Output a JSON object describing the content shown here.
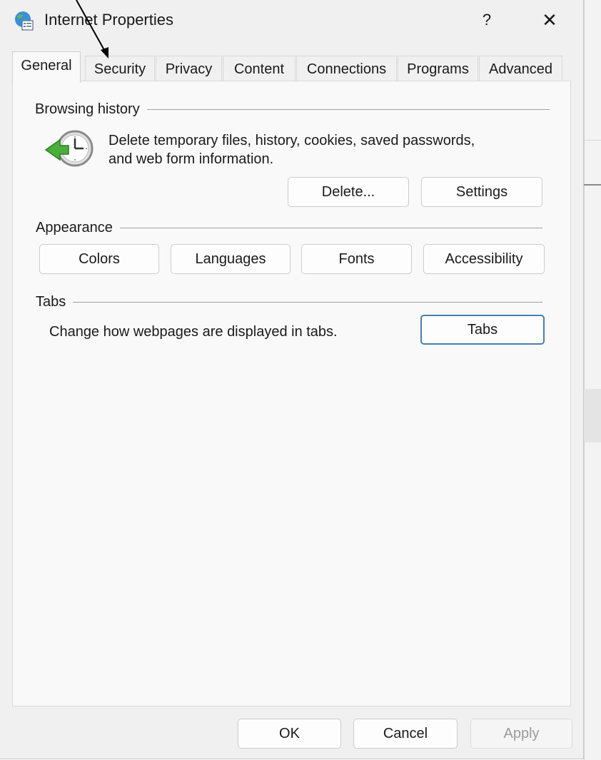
{
  "window": {
    "title": "Internet Properties",
    "help_label": "?",
    "close_label": "✕"
  },
  "tabs": [
    {
      "label": "General",
      "active": true
    },
    {
      "label": "Security",
      "active": false
    },
    {
      "label": "Privacy",
      "active": false
    },
    {
      "label": "Content",
      "active": false
    },
    {
      "label": "Connections",
      "active": false
    },
    {
      "label": "Programs",
      "active": false
    },
    {
      "label": "Advanced",
      "active": false
    }
  ],
  "browsing_history": {
    "label": "Browsing history",
    "icon": "history-clock-icon",
    "description_line1": "Delete temporary files, history, cookies, saved passwords,",
    "description_line2": "and web form information.",
    "delete_label": "Delete...",
    "settings_label": "Settings"
  },
  "appearance": {
    "label": "Appearance",
    "colors_label": "Colors",
    "languages_label": "Languages",
    "fonts_label": "Fonts",
    "accessibility_label": "Accessibility"
  },
  "tabs_group": {
    "label": "Tabs",
    "description": "Change how webpages are displayed in tabs.",
    "tabs_button_label": "Tabs"
  },
  "footer": {
    "ok_label": "OK",
    "cancel_label": "Cancel",
    "apply_label": "Apply"
  },
  "colors": {
    "focus_border": "#4a7fb0",
    "dialog_bg": "#f0f0f0",
    "panel_bg": "#f9f9f9"
  }
}
